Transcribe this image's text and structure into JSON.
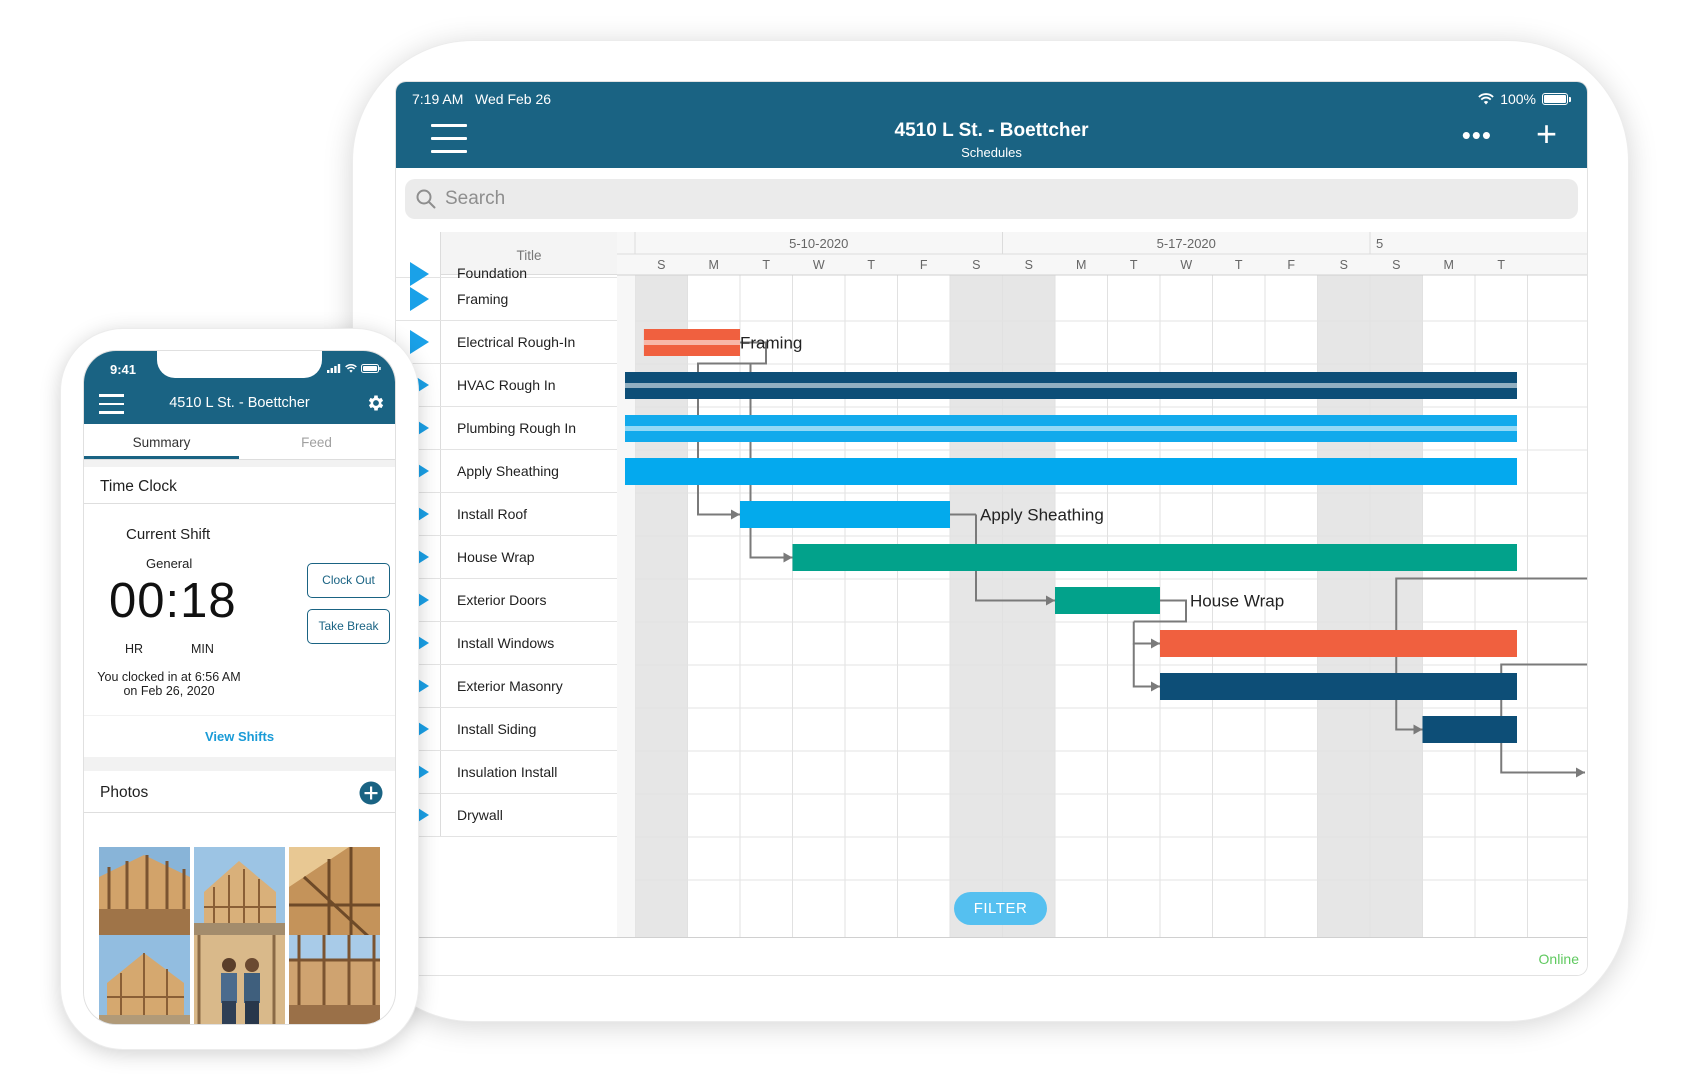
{
  "tablet": {
    "status": {
      "time": "7:19 AM",
      "date": "Wed Feb 26",
      "battery": "100%"
    },
    "header": {
      "title": "4510 L St. - Boettcher",
      "subtitle": "Schedules",
      "more_icon": "ellipsis-icon",
      "add_icon": "plus-icon"
    },
    "search": {
      "placeholder": "Search"
    },
    "list": {
      "header": "Title",
      "items": [
        {
          "label": "Foundation"
        },
        {
          "label": "Framing"
        },
        {
          "label": "Electrical Rough-In"
        },
        {
          "label": "HVAC Rough In"
        },
        {
          "label": "Plumbing Rough In"
        },
        {
          "label": "Apply Sheathing"
        },
        {
          "label": "Install Roof"
        },
        {
          "label": "House Wrap"
        },
        {
          "label": "Exterior Doors"
        },
        {
          "label": "Install Windows"
        },
        {
          "label": "Exterior Masonry"
        },
        {
          "label": "Install Siding"
        },
        {
          "label": "Insulation Install"
        },
        {
          "label": "Drywall"
        }
      ]
    },
    "timeline": {
      "weeks": [
        "5-10-2020",
        "5-17-2020",
        "5"
      ],
      "days": [
        "S",
        "M",
        "T",
        "W",
        "T",
        "F",
        "S",
        "S",
        "M",
        "T",
        "W",
        "T",
        "F",
        "S",
        "S",
        "M",
        "T"
      ],
      "weekend_day_indices": [
        0,
        6,
        7,
        13,
        14
      ]
    },
    "tasks": [
      {
        "row": 1,
        "start": 0.17,
        "end": 2.0,
        "color": "#f0603f",
        "style": "striped",
        "label": "Framing"
      },
      {
        "row": 2,
        "start": 0,
        "end": 16.8,
        "color": "#0d4e77",
        "style": "striped",
        "label": ""
      },
      {
        "row": 3,
        "start": 0,
        "end": 16.8,
        "color": "#12aaec",
        "style": "striped",
        "label": ""
      },
      {
        "row": 4,
        "start": 0,
        "end": 16.8,
        "color": "#04a9ee",
        "style": "solid",
        "label": ""
      },
      {
        "row": 5,
        "start": 2.0,
        "end": 6.0,
        "color": "#03aaec",
        "style": "solid",
        "label": "Apply Sheathing"
      },
      {
        "row": 6,
        "start": 3.0,
        "end": 16.8,
        "color": "#02a28b",
        "style": "solid",
        "label": ""
      },
      {
        "row": 7,
        "start": 8.0,
        "end": 10.0,
        "color": "#02a28b",
        "style": "solid",
        "label": "House Wrap"
      },
      {
        "row": 8,
        "start": 10.0,
        "end": 16.8,
        "color": "#f0603f",
        "style": "solid",
        "label": ""
      },
      {
        "row": 9,
        "start": 10.0,
        "end": 16.8,
        "color": "#0d4e77",
        "style": "solid",
        "label": ""
      },
      {
        "row": 10,
        "start": 15.0,
        "end": 16.8,
        "color": "#0d4e77",
        "style": "solid",
        "label": ""
      }
    ],
    "filter_label": "FILTER",
    "online_label": "Online"
  },
  "phone": {
    "status": {
      "time": "9:41"
    },
    "header": {
      "title": "4510 L St. - Boettcher",
      "menu_icon": "hamburger-icon",
      "settings_icon": "gear-icon"
    },
    "tabs": [
      "Summary",
      "Feed"
    ],
    "time_clock": {
      "title": "Time Clock",
      "current_shift": "Current Shift",
      "shift_type": "General",
      "elapsed": "00:18",
      "hr_label": "HR",
      "min_label": "MIN",
      "clocked_in_line1": "You clocked in at 6:56 AM",
      "clocked_in_line2": "on Feb 26, 2020",
      "clock_out": "Clock Out",
      "take_break": "Take Break",
      "view_shifts": "View Shifts"
    },
    "photos": {
      "title": "Photos",
      "add_icon": "plus-circle-icon"
    }
  }
}
